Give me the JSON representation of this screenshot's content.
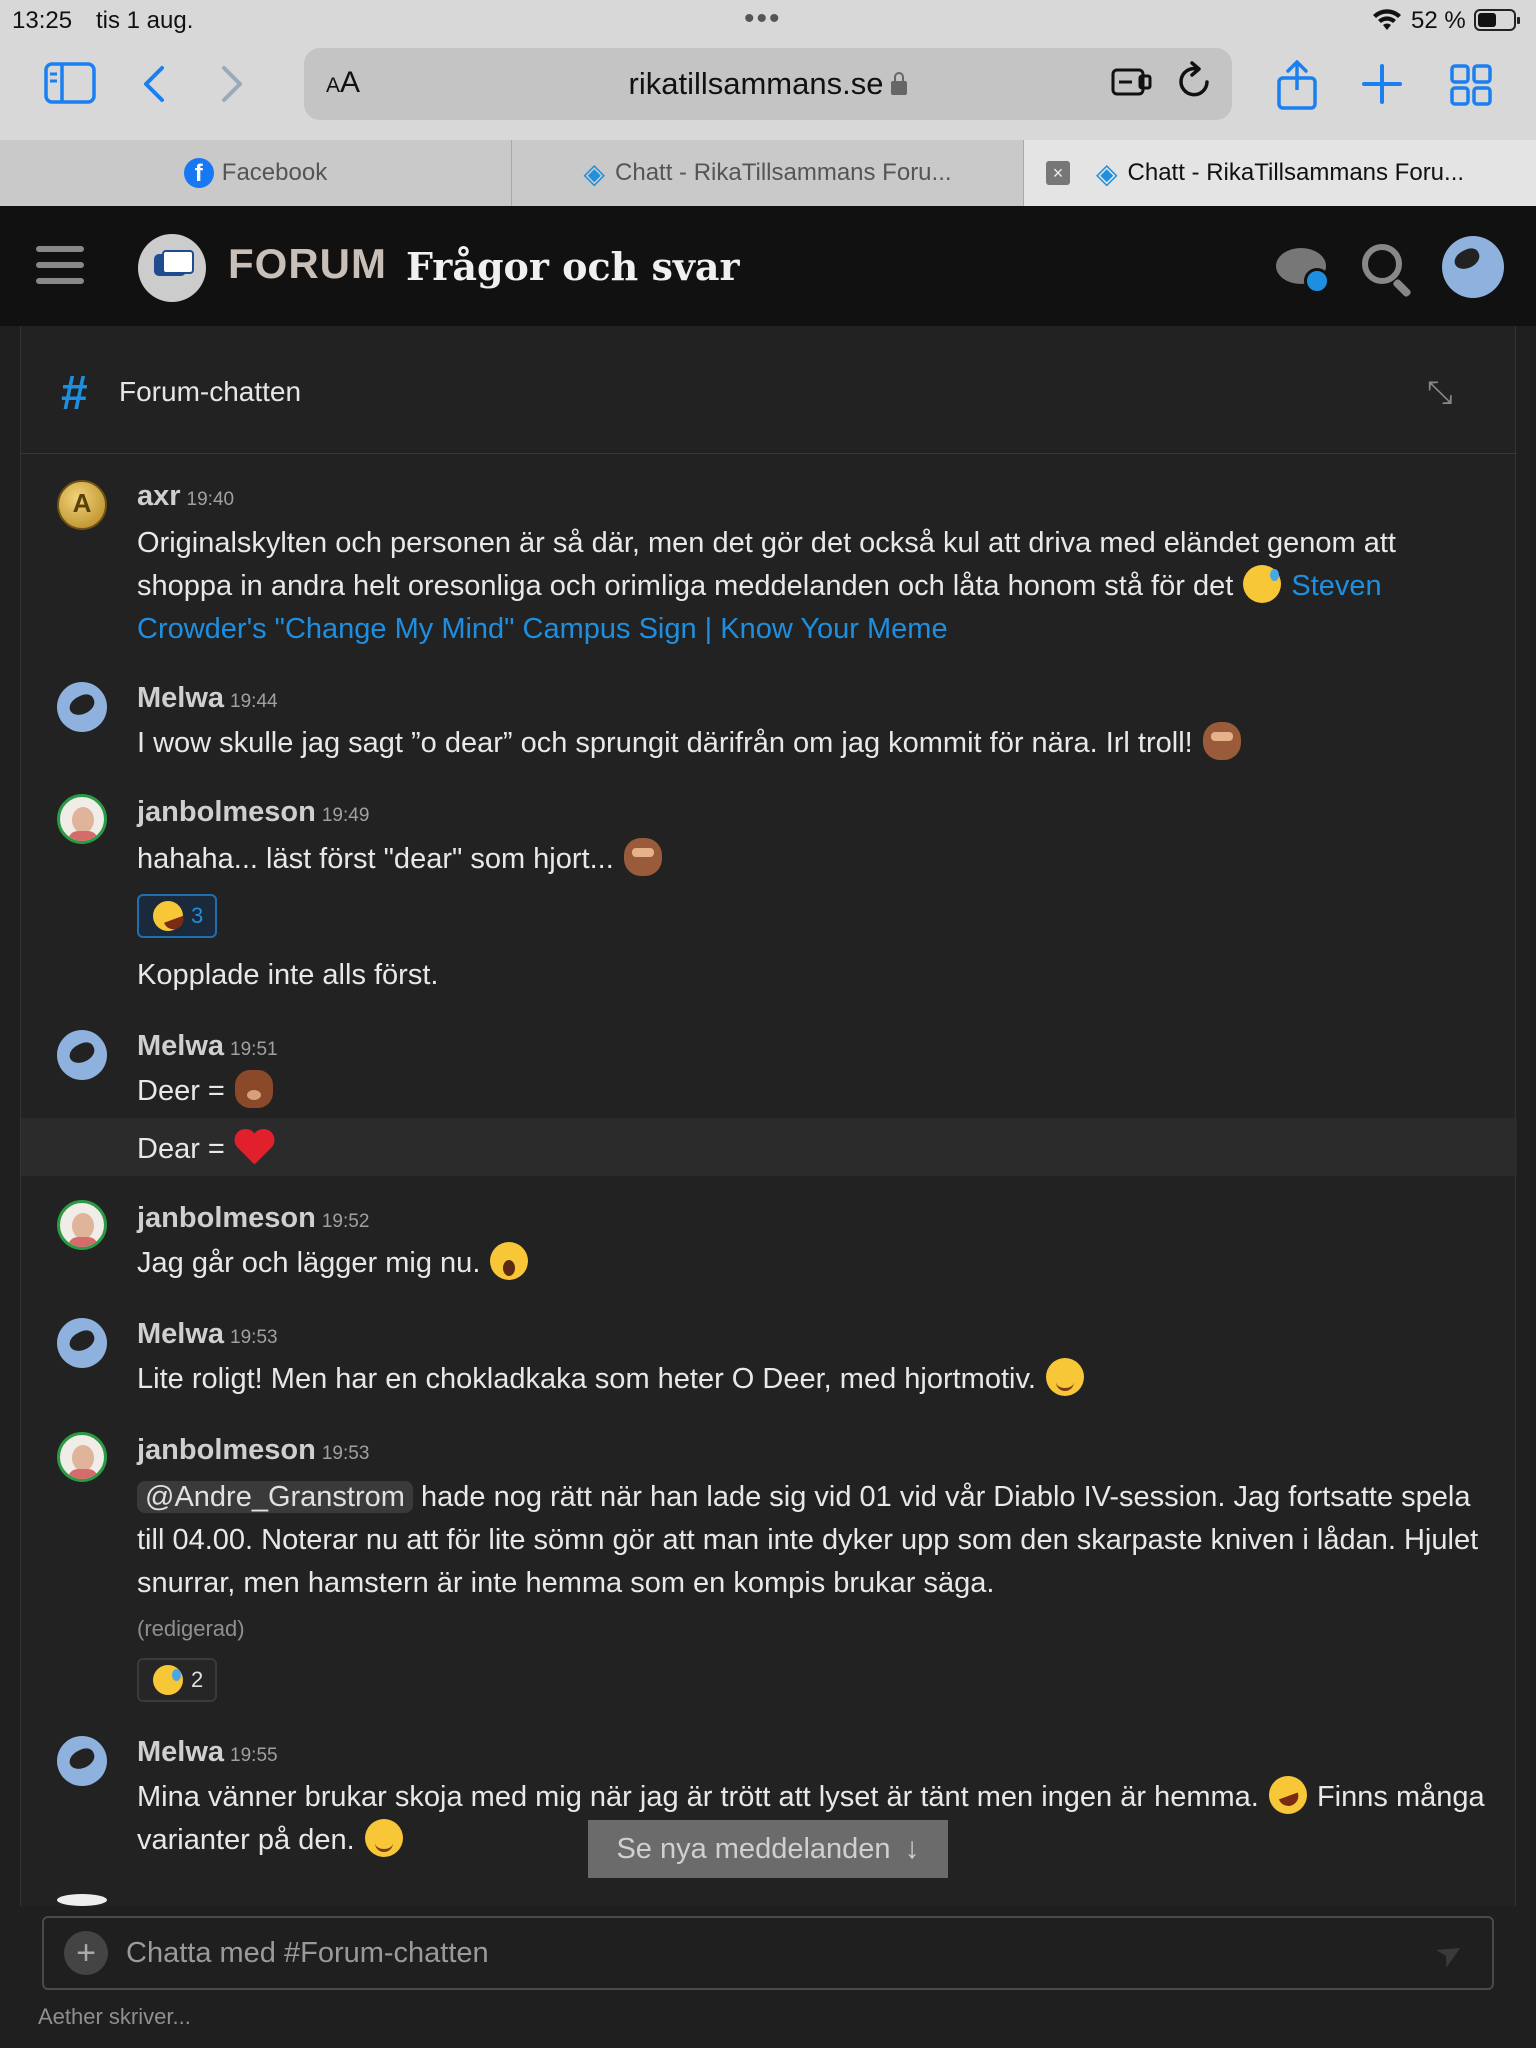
{
  "status_bar": {
    "time": "13:25",
    "date": "tis 1 aug.",
    "battery": "52 %"
  },
  "browser": {
    "text_size": "AA",
    "url": "rikatillsammans.se",
    "tabs": [
      {
        "label": "Facebook"
      },
      {
        "label": "Chatt - RikaTillsammans Foru..."
      },
      {
        "label": "Chatt - RikaTillsammans Foru..."
      }
    ]
  },
  "forum": {
    "logo_text": "FORUM",
    "subtitle": "Frågor och svar"
  },
  "channel": {
    "name": "Forum-chatten"
  },
  "messages": [
    {
      "author": "axr",
      "time": "19:40",
      "text": "Originalskylten och personen är så där, men det gör det också kul att driva med eländet genom att shoppa in andra helt oresonliga och orimliga meddelanden och låta honom stå för det",
      "link": "Steven Crowder's \"Change My Mind\" Campus Sign | Know Your Meme"
    },
    {
      "author": "Melwa",
      "time": "19:44",
      "text": "I wow skulle jag sagt ”o dear” och sprungit därifrån om jag kommit för nära. Irl troll!"
    },
    {
      "author": "janbolmeson",
      "time": "19:49",
      "text": "hahaha... läst först \"dear\" som hjort...",
      "reaction_count": "3",
      "text2": "Kopplade inte alls först."
    },
    {
      "author": "Melwa",
      "time": "19:51",
      "text": "Deer =",
      "text2": "Dear ="
    },
    {
      "author": "janbolmeson",
      "time": "19:52",
      "text": "Jag går och lägger mig nu."
    },
    {
      "author": "Melwa",
      "time": "19:53",
      "text": "Lite roligt! Men har en chokladkaka som heter O Deer, med hjortmotiv."
    },
    {
      "author": "janbolmeson",
      "time": "19:53",
      "mention": "@Andre_Granstrom",
      "text": "hade nog rätt när han lade sig vid 01 vid vår Diablo IV-session. Jag fortsatte spela till 04.00. Noterar nu att för lite sömn gör att man inte dyker upp som den skarpaste kniven i lådan. Hjulet snurrar, men hamstern är inte hemma som en kompis brukar säga.",
      "edited": "(redigerad)",
      "reaction_count": "2"
    },
    {
      "author": "Melwa",
      "time": "19:55",
      "text": "Mina vänner brukar skoja med mig när jag är trött att lyset är tänt men ingen är hemma.",
      "text_after": "Finns många varianter på den."
    }
  ],
  "new_messages_button": "Se nya meddelanden",
  "composer": {
    "placeholder": "Chatta med #Forum-chatten"
  },
  "typing_indicator": "Aether skriver...",
  "colors": {
    "accent": "#1e8fe0",
    "background": "#222222",
    "header": "#111111"
  }
}
